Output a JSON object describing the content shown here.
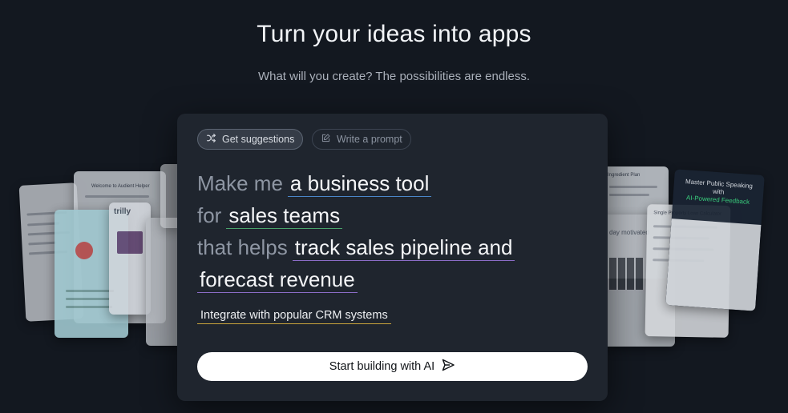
{
  "hero": {
    "title": "Turn your ideas into apps",
    "subtitle": "What will you create? The possibilities are endless."
  },
  "tabs": {
    "suggestions": {
      "label": "Get suggestions",
      "icon": "shuffle-icon"
    },
    "prompt": {
      "label": "Write a prompt",
      "icon": "edit-icon"
    }
  },
  "prompt": {
    "prefix1": "Make me",
    "slot1": "a business tool",
    "prefix2": "for",
    "slot2": "sales teams",
    "prefix3": "that helps",
    "slot3a": "track sales pipeline and",
    "slot3b": "forecast revenue"
  },
  "feature": {
    "label": "Integrate with popular CRM systems"
  },
  "cta": {
    "label": "Start building with AI",
    "icon": "send-icon"
  },
  "previews": {
    "welcome": "Welcome to Audient Helper",
    "trilly": "trilly",
    "master_title": "Master Public Speaking with",
    "master_accent": "AI-Powered Feedback",
    "property": "Single Property Loan Calculator",
    "motivated": "day motivated",
    "planner": "Ingredient Plan"
  },
  "colors": {
    "background": "#131820",
    "card": "#1f252e",
    "slot_blue": "#4a86c8",
    "slot_green": "#49a36b",
    "slot_purple": "#8b6cc6",
    "feature_underline": "#c9a53c",
    "accent_green": "#3ddc84"
  }
}
